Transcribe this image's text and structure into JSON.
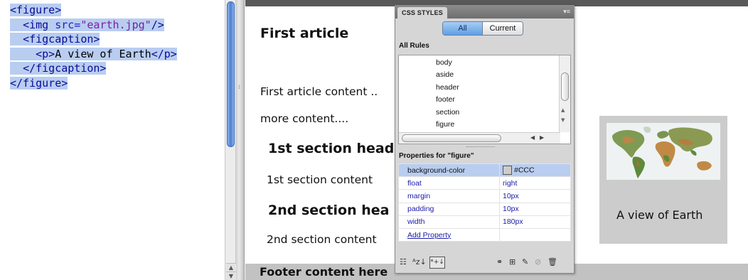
{
  "code": {
    "lines": [
      "<figure>",
      "<img src=\"earth.jpg\"/>",
      "<figcaption>",
      "<p>A view of Earth</p>",
      "</figcaption>",
      "</figure>"
    ]
  },
  "design": {
    "article_title": "First article",
    "article_content": "First article content ..",
    "more_content": "more content....",
    "section1_heading": "1st section head",
    "section1_content": "1st section content",
    "section2_heading": "2nd section hea",
    "section2_content": "2nd section content",
    "footer_text": "Footer content here",
    "figure": {
      "caption": "A view of Earth",
      "background_color": "#cccccc"
    }
  },
  "css_panel": {
    "tab_label": "CSS STYLES",
    "menu_icon": "panel-menu-icon",
    "mode_all": "All",
    "mode_current": "Current",
    "all_rules_label": "All Rules",
    "rules": [
      "body",
      "aside",
      "header",
      "footer",
      "section",
      "figure"
    ],
    "properties_label": "Properties for \"figure\"",
    "properties": [
      {
        "name": "background-color",
        "value": "#CCC",
        "selected": true
      },
      {
        "name": "float",
        "value": "right"
      },
      {
        "name": "margin",
        "value": "10px"
      },
      {
        "name": "padding",
        "value": "10px"
      },
      {
        "name": "width",
        "value": "180px"
      }
    ],
    "add_property": "Add Property",
    "footer_icons": [
      "category-view-icon",
      "alphabetical-view-icon",
      "set-properties-view-icon",
      "attach-stylesheet-icon",
      "new-rule-icon",
      "edit-rule-icon",
      "disable-icon",
      "trash-icon"
    ]
  }
}
